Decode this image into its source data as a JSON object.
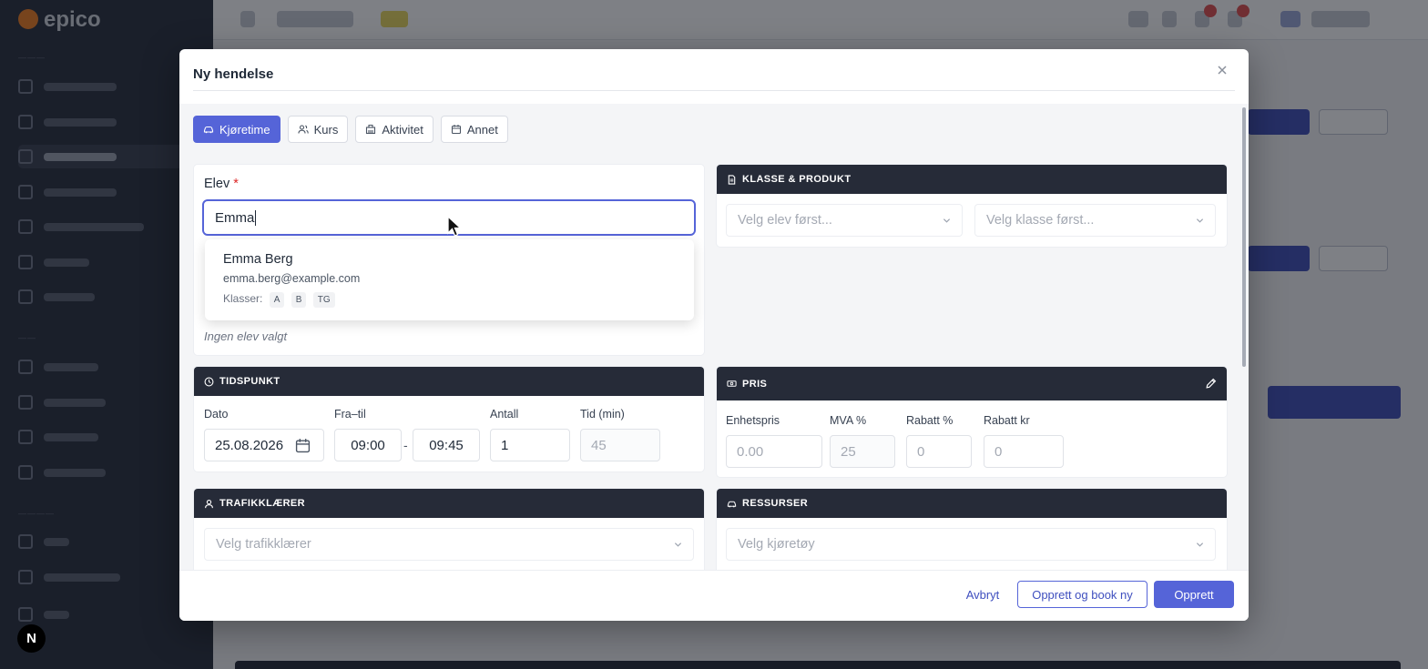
{
  "background": {
    "app_logo": "epico",
    "n_badge": "N"
  },
  "modal": {
    "title": "Ny hendelse",
    "tabs": [
      {
        "label": "Kjøretime",
        "icon": "car-icon",
        "active": true
      },
      {
        "label": "Kurs",
        "icon": "users-icon",
        "active": false
      },
      {
        "label": "Aktivitet",
        "icon": "building-icon",
        "active": false
      },
      {
        "label": "Annet",
        "icon": "calendar-icon",
        "active": false
      }
    ],
    "elev": {
      "label": "Elev",
      "required_mark": "*",
      "value": "Emma",
      "empty_text": "Ingen elev valgt",
      "suggestion": {
        "name": "Emma Berg",
        "email": "emma.berg@example.com",
        "classes_label": "Klasser:",
        "classes": [
          "A",
          "B",
          "TG"
        ]
      }
    },
    "klasse_produkt": {
      "title": "KLASSE & PRODUKT",
      "elev_select_placeholder": "Velg elev først...",
      "klasse_select_placeholder": "Velg klasse først..."
    },
    "tidspunkt": {
      "title": "TIDSPUNKT",
      "dato_label": "Dato",
      "dato_value": "25.08.2026",
      "fra_til_label": "Fra–til",
      "fra_value": "09:00",
      "separator": "-",
      "til_value": "09:45",
      "antall_label": "Antall",
      "antall_value": "1",
      "tid_label": "Tid (min)",
      "tid_value": "45"
    },
    "pris": {
      "title": "PRIS",
      "enhetspris_label": "Enhetspris",
      "enhetspris_placeholder": "0.00",
      "mva_label": "MVA %",
      "mva_value": "25",
      "rabatt_pct_label": "Rabatt %",
      "rabatt_pct_value": "0",
      "rabatt_kr_label": "Rabatt kr",
      "rabatt_kr_value": "0"
    },
    "trafikklaerer": {
      "title": "TRAFIKKLÆRER",
      "placeholder": "Velg trafikklærer"
    },
    "ressurser": {
      "title": "RESSURSER",
      "placeholder": "Velg kjøretøy"
    },
    "footer": {
      "cancel": "Avbryt",
      "create_and_new": "Opprett og book ny",
      "create": "Opprett"
    }
  },
  "colors": {
    "primary": "#5564d8",
    "card_header": "#262b38"
  }
}
